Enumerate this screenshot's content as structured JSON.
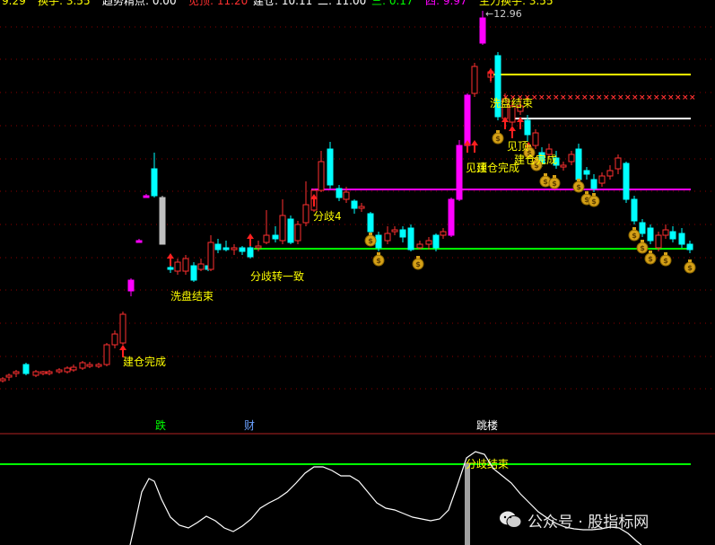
{
  "header": {
    "items": [
      {
        "label": "换手",
        "value": "3.55",
        "color": "#ffff00"
      },
      {
        "label": "趋势精点",
        "value": "0.00",
        "color": "#ffffff"
      },
      {
        "label": "见顶",
        "value": "11.20",
        "color": "#ff3030"
      },
      {
        "label": "建仓",
        "value": "10.11",
        "color": "#ffffff"
      },
      {
        "label": "二",
        "value": "11.00",
        "color": "#ffffff"
      },
      {
        "label": "三",
        "value": "0.17",
        "color": "#00ff00"
      },
      {
        "label": "四",
        "value": "9.97",
        "color": "#ff00ff"
      },
      {
        "label": "主力换手",
        "value": "3.55",
        "color": "#ffff00"
      }
    ],
    "first_value": "9.29"
  },
  "price_high_label": "12.96",
  "annotations": [
    {
      "text": "建仓完成",
      "key": "jc1"
    },
    {
      "text": "洗盘结束",
      "key": "xp1"
    },
    {
      "text": "分歧转一致",
      "key": "fz"
    },
    {
      "text": "分歧4",
      "key": "fq4"
    },
    {
      "text": "见顶",
      "key": "jd1"
    },
    {
      "text": "建仓完成",
      "key": "jc2"
    },
    {
      "text": "洗盘结束",
      "key": "xp2"
    },
    {
      "text": "见顶",
      "key": "jd2"
    },
    {
      "text": "建仓完成",
      "key": "jc3"
    }
  ],
  "markers": {
    "die": "跌",
    "cai": "财",
    "tiao": "跳楼"
  },
  "indicator_label": "分歧结束",
  "watermark": "公众号 · 股指标网",
  "colors": {
    "up": "#ff3030",
    "down": "#00ffff",
    "magenta": "#ff00ff",
    "green": "#00ff00",
    "yellow": "#ffff00",
    "white": "#ffffff",
    "grid": "#8b0000",
    "bg": "#000000"
  },
  "chart_data": {
    "type": "candlestick",
    "high": 12.96,
    "levels": [
      {
        "name": "yellow-line",
        "color": "#ffff00"
      },
      {
        "name": "red-x-line",
        "color": "#ff3030"
      },
      {
        "name": "white-line",
        "color": "#ffffff"
      },
      {
        "name": "magenta-line",
        "color": "#ff00ff"
      },
      {
        "name": "green-line",
        "color": "#00ff00"
      }
    ]
  }
}
